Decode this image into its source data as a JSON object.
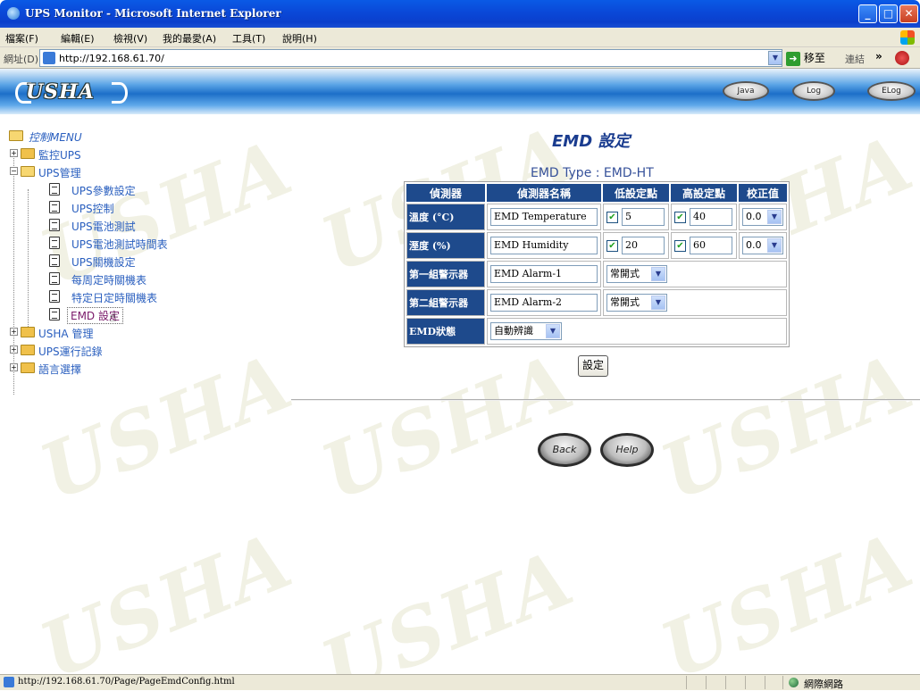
{
  "window": {
    "title": "UPS Monitor - Microsoft Internet Explorer",
    "min": "_",
    "max": "□",
    "close": "✕"
  },
  "menubar": {
    "items": [
      "檔案(F)",
      "編輯(E)",
      "檢視(V)",
      "我的最愛(A)",
      "工具(T)",
      "說明(H)"
    ]
  },
  "addressbar": {
    "label": "網址(D)",
    "url": "http://192.168.61.70/",
    "go_label": "移至",
    "links_label": "連結",
    "links_chevron": "»"
  },
  "header": {
    "logo_text": "USHA",
    "buttons": [
      "Java",
      "Log",
      "ELog"
    ]
  },
  "tree": {
    "root": "控制MENU",
    "items": [
      {
        "label": "監控UPS",
        "type": "folder"
      },
      {
        "label": "UPS管理",
        "type": "folder-open"
      },
      {
        "label": "UPS參數設定",
        "type": "page"
      },
      {
        "label": "UPS控制",
        "type": "page"
      },
      {
        "label": "UPS電池測試",
        "type": "page"
      },
      {
        "label": "UPS電池測試時間表",
        "type": "page"
      },
      {
        "label": "UPS關機設定",
        "type": "page"
      },
      {
        "label": "每周定時關機表",
        "type": "page"
      },
      {
        "label": "特定日定時關機表",
        "type": "page"
      },
      {
        "label": "EMD 設定",
        "type": "page",
        "selected": true
      },
      {
        "label": "USHA 管理",
        "type": "folder"
      },
      {
        "label": "UPS運行記錄",
        "type": "folder"
      },
      {
        "label": "語言選擇",
        "type": "folder"
      }
    ]
  },
  "emd": {
    "title": "EMD 設定",
    "type_text": "EMD Type : EMD-HT",
    "headers": [
      "偵測器",
      "偵測器名稱",
      "低設定點",
      "高設定點",
      "校正值"
    ],
    "rows": [
      {
        "label": "溫度 (°C)",
        "name": "EMD Temperature",
        "low": "5",
        "high": "40",
        "cal": "0.0"
      },
      {
        "label": "溼度 (%)",
        "name": "EMD Humidity",
        "low": "20",
        "high": "60",
        "cal": "0.0"
      }
    ],
    "alarms": [
      {
        "label": "第一組警示器",
        "name": "EMD Alarm-1",
        "mode": "常開式"
      },
      {
        "label": "第二組警示器",
        "name": "EMD Alarm-2",
        "mode": "常開式"
      }
    ],
    "status_label": "EMD狀態",
    "status_value": "自動辨識",
    "set_button": "設定",
    "back_button": "Back",
    "help_button": "Help"
  },
  "statusbar": {
    "url": "http://192.168.61.70/Page/PageEmdConfig.html",
    "zone": "網際網路"
  },
  "colors": {
    "header_blue": "#1e4a8c",
    "tree_link": "#2a5fbf",
    "title_blue": "#1a3c8f"
  }
}
